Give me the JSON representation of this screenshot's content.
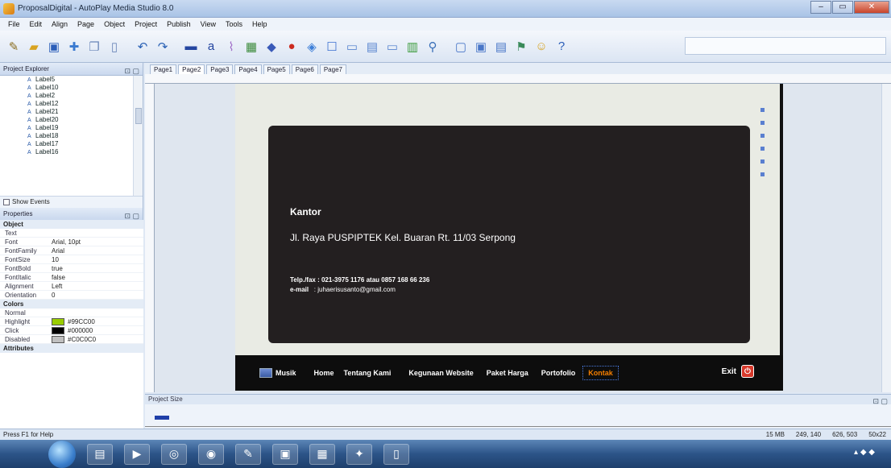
{
  "window": {
    "title": "ProposalDigital - AutoPlay Media Studio 8.0",
    "controls": [
      "–",
      "▭",
      "✕"
    ]
  },
  "menu": [
    "File",
    "Edit",
    "Align",
    "Page",
    "Object",
    "Project",
    "Publish",
    "View",
    "Tools",
    "Help"
  ],
  "toolbar_icons": [
    "wand-icon",
    "open-folder-icon",
    "save-icon",
    "add-page-icon",
    "copy-icon",
    "paste-icon",
    "undo-icon",
    "redo-icon",
    "chart-icon",
    "label-icon",
    "paragraph-icon",
    "image-icon",
    "button-icon",
    "record-icon",
    "flash-icon",
    "input-icon",
    "listbox-icon",
    "combo-icon",
    "progress-icon",
    "tree-icon",
    "search-icon",
    "page-new-icon",
    "page-copy-icon",
    "page-props-icon",
    "build-icon",
    "smiley-icon",
    "help-icon"
  ],
  "project_explorer": {
    "title": "Project Explorer",
    "items": [
      "Label5",
      "Label10",
      "Label2",
      "Label12",
      "Label21",
      "Label20",
      "Label19",
      "Label18",
      "Label17",
      "Label16"
    ],
    "show_events": "Show Events"
  },
  "properties": {
    "title": "Properties",
    "groups": [
      {
        "name": "Object",
        "rows": [
          {
            "name": "Text",
            "value": ""
          },
          {
            "name": "Font",
            "value": "Arial, 10pt"
          },
          {
            "name": "FontFamily",
            "value": "Arial"
          },
          {
            "name": "FontSize",
            "value": "10"
          },
          {
            "name": "FontBold",
            "value": "true"
          },
          {
            "name": "FontItalic",
            "value": "false"
          },
          {
            "name": "Alignment",
            "value": "Left"
          },
          {
            "name": "Orientation",
            "value": "0"
          }
        ]
      },
      {
        "name": "Colors",
        "rows": [
          {
            "name": "Normal",
            "value": ""
          },
          {
            "name": "Highlight",
            "value": "#99CC00",
            "swatch": "#99cc00"
          },
          {
            "name": "Click",
            "value": "#000000",
            "swatch": "#000000"
          },
          {
            "name": "Disabled",
            "value": "#C0C0C0",
            "swatch": "#c0c0c0"
          }
        ]
      },
      {
        "name": "Attributes",
        "rows": []
      }
    ]
  },
  "pages": [
    "Page1",
    "Page2",
    "Page3",
    "Page4",
    "Page5",
    "Page6",
    "Page7"
  ],
  "active_page": "Page2",
  "canvas": {
    "heading": "Kantor",
    "address": "Jl. Raya PUSPIPTEK Kel. Buaran Rt. 11/03 Serpong",
    "phone_label": "Telp./fax",
    "phone_value": ": 021-3975 1176 atau 0857 168 66 236",
    "email_label": "e-mail",
    "email_value": ": juhaerisusanto@gmail.com"
  },
  "nav": {
    "logo_label": "Musik",
    "items": [
      "Home",
      "Tentang Kami",
      "Kegunaan Website",
      "Paket Harga",
      "Portofolio",
      "Kontak"
    ],
    "exit": "Exit",
    "active_color": "#f57f00"
  },
  "project_size": {
    "title": "Project Size"
  },
  "status": {
    "help": "Press F1 for Help",
    "size": "15 MB",
    "cursor": "249, 140",
    "position": "626, 503",
    "dimensions": "50x22"
  }
}
